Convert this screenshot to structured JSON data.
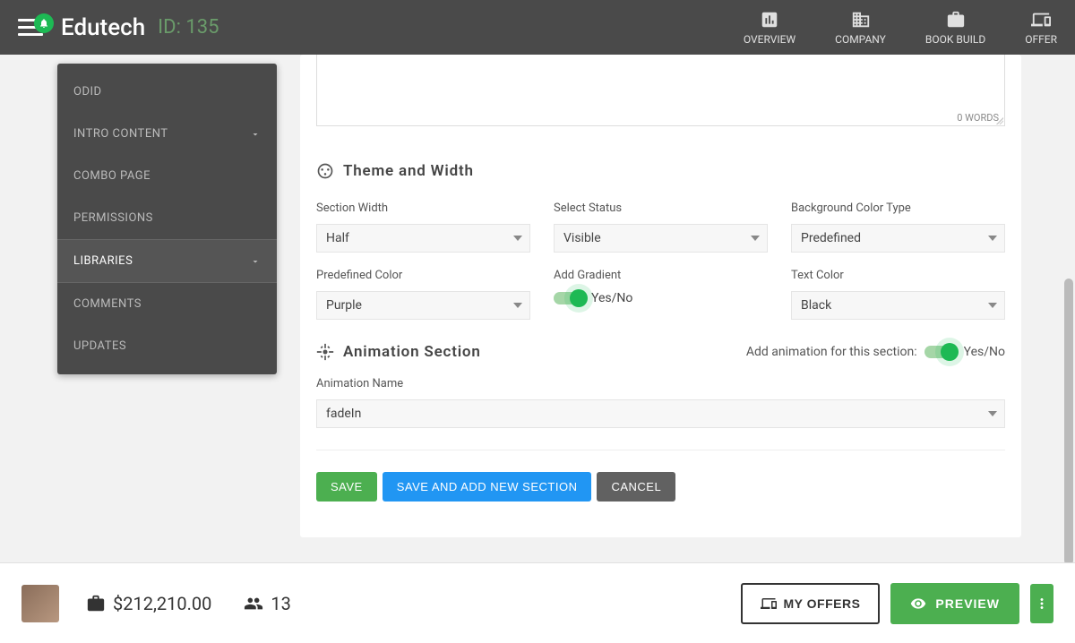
{
  "header": {
    "brand": "Edutech",
    "id_label": "ID: 135",
    "nav": [
      {
        "label": "OVERVIEW"
      },
      {
        "label": "COMPANY"
      },
      {
        "label": "BOOK BUILD"
      },
      {
        "label": "OFFER"
      }
    ]
  },
  "sidebar": {
    "items": [
      {
        "label": "ODID"
      },
      {
        "label": "INTRO CONTENT",
        "expandable": true
      },
      {
        "label": "COMBO PAGE"
      },
      {
        "label": "PERMISSIONS"
      },
      {
        "label": "LIBRARIES",
        "expandable": true,
        "selected": true
      },
      {
        "label": "COMMENTS"
      },
      {
        "label": "UPDATES"
      }
    ]
  },
  "editor": {
    "word_count": "0 WORDS"
  },
  "theme_section": {
    "title": "Theme and Width",
    "fields": {
      "section_width": {
        "label": "Section Width",
        "value": "Half"
      },
      "select_status": {
        "label": "Select Status",
        "value": "Visible"
      },
      "bg_color_type": {
        "label": "Background Color Type",
        "value": "Predefined"
      },
      "predefined_color": {
        "label": "Predefined Color",
        "value": "Purple"
      },
      "add_gradient": {
        "label": "Add Gradient",
        "value": "Yes/No"
      },
      "text_color": {
        "label": "Text Color",
        "value": "Black"
      }
    }
  },
  "animation_section": {
    "title": "Animation Section",
    "toggle_label": "Add animation for this section:",
    "toggle_value": "Yes/No",
    "name_label": "Animation Name",
    "name_value": "fadeIn"
  },
  "actions": {
    "save": "SAVE",
    "save_new": "SAVE AND ADD NEW SECTION",
    "cancel": "CANCEL"
  },
  "footer": {
    "amount": "$212,210.00",
    "count": "13",
    "my_offers": "MY OFFERS",
    "preview": "PREVIEW"
  }
}
